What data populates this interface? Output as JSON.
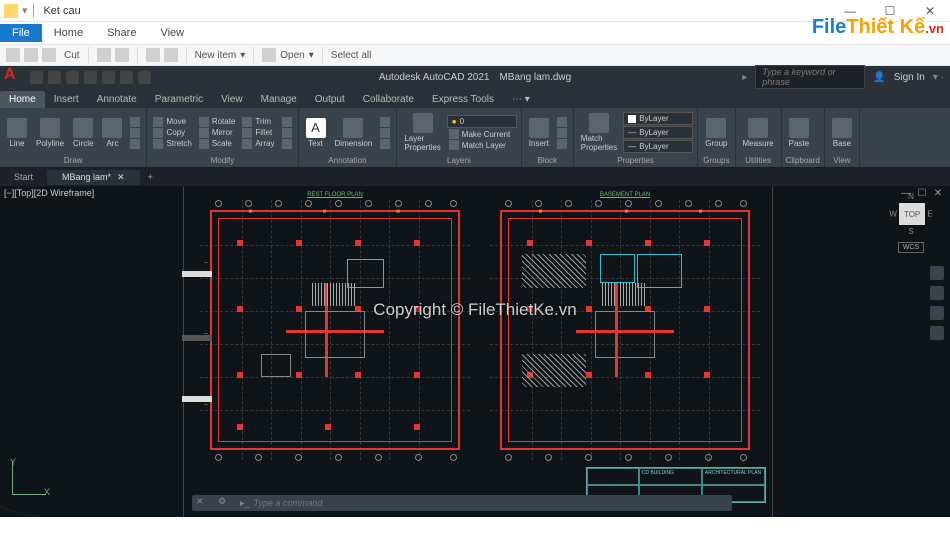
{
  "explorer": {
    "window_title": "Ket cau",
    "tabs": {
      "file": "File",
      "home": "Home",
      "share": "Share",
      "view": "View"
    },
    "toolbar": {
      "cut": "Cut",
      "new_item": "New item",
      "open": "Open",
      "select_all": "Select all"
    }
  },
  "acad": {
    "product": "Autodesk AutoCAD 2021",
    "filename": "MBang lam.dwg",
    "search_placeholder": "Type a keyword or phrase",
    "sign_in": "Sign In"
  },
  "ribbon_tabs": [
    "Home",
    "Insert",
    "Annotate",
    "Parametric",
    "View",
    "Manage",
    "Output",
    "Collaborate",
    "Express Tools"
  ],
  "ribbon": {
    "draw": {
      "title": "Draw",
      "line": "Line",
      "polyline": "Polyline",
      "circle": "Circle",
      "arc": "Arc"
    },
    "modify": {
      "title": "Modify",
      "move": "Move",
      "rotate": "Rotate",
      "trim": "Trim",
      "copy": "Copy",
      "mirror": "Mirror",
      "fillet": "Fillet",
      "stretch": "Stretch",
      "scale": "Scale",
      "array": "Array"
    },
    "annotation": {
      "title": "Annotation",
      "text": "Text",
      "dimension": "Dimension"
    },
    "layers": {
      "title": "Layers",
      "layer_props": "Layer\nProperties",
      "make_current": "Make Current",
      "match_layer": "Match Layer"
    },
    "block": {
      "title": "Block",
      "insert": "Insert"
    },
    "properties": {
      "title": "Properties",
      "match": "Match\nProperties",
      "bylayer": "ByLayer"
    },
    "groups": {
      "title": "Groups",
      "group": "Group"
    },
    "utilities": {
      "title": "Utilities",
      "measure": "Measure"
    },
    "clipboard": {
      "title": "Clipboard",
      "paste": "Paste"
    },
    "view": {
      "title": "View",
      "base": "Base"
    }
  },
  "doc_tabs": {
    "start": "Start",
    "active": "MBang lam*"
  },
  "viewport": {
    "label": "[−][Top][2D Wireframe]",
    "plan1_title": "REST FLOOR PLAN",
    "plan2_title": "BASEMENT PLAN",
    "ucs_x": "X",
    "ucs_y": "Y",
    "cube": {
      "n": "N",
      "s": "S",
      "e": "E",
      "w": "W",
      "top": "TOP",
      "wcs": "WCS"
    }
  },
  "titleblock": {
    "project": "CD BUILDING",
    "sheet": "ARCHITECTURAL PLAN"
  },
  "cmdline": {
    "placeholder": "Type a command"
  },
  "watermark": {
    "brand1": "File",
    "brand2": "Thiết Kế",
    "brand3": ".vn",
    "center": "Copyright © FileThietKe.vn"
  }
}
